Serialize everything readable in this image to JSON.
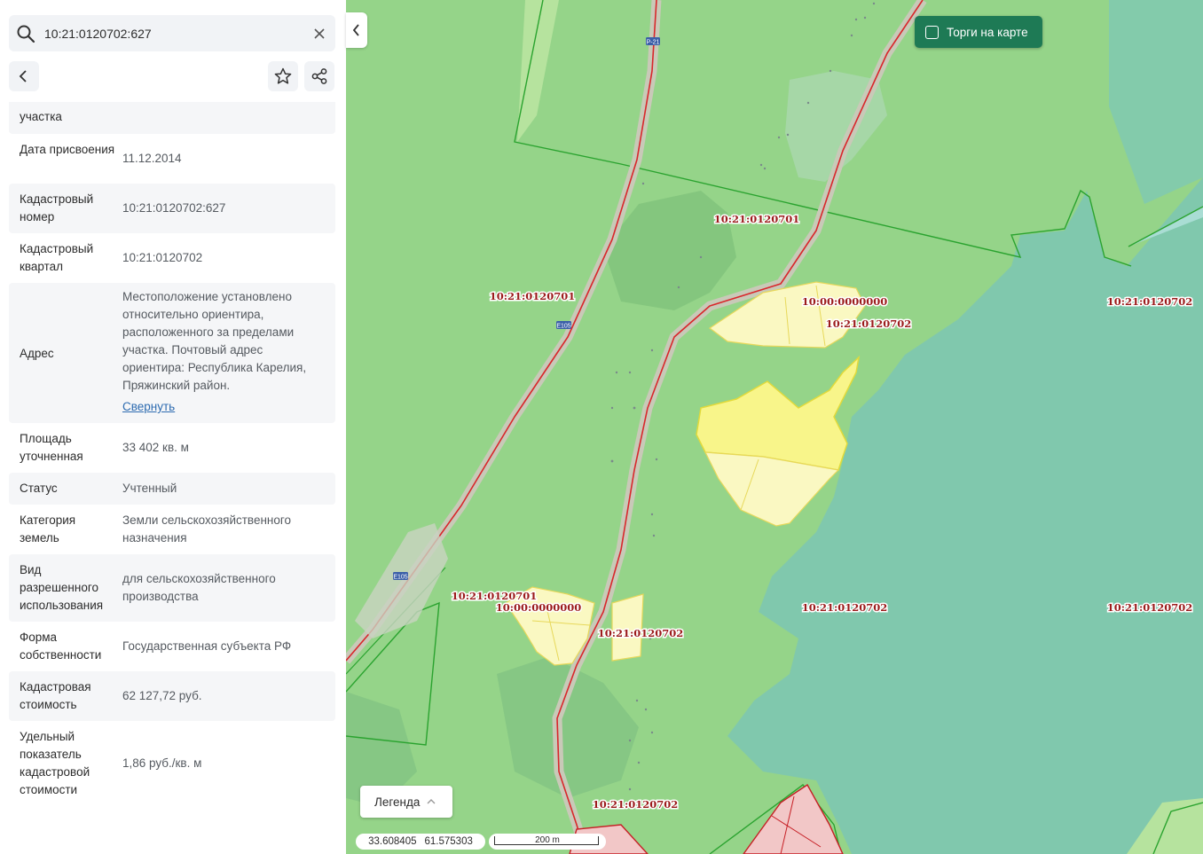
{
  "search": {
    "value": "10:21:0120702:627"
  },
  "icons": {
    "search": "search-icon",
    "clear": "close-icon",
    "back": "chevron-left-icon",
    "favorite": "star-icon",
    "share": "share-icon",
    "collapse": "chevron-left-icon",
    "legend_chevron": "chevron-up-icon"
  },
  "info": {
    "partial_label": "участка",
    "rows": [
      {
        "label": "Дата присвоения",
        "value": "11.12.2014"
      },
      {
        "label": "Кадастровый номер",
        "value": "10:21:0120702:627"
      },
      {
        "label": "Кадастровый квартал",
        "value": "10:21:0120702"
      },
      {
        "label": "Адрес",
        "value": "Местоположение установлено относительно ориентира, расположенного за пределами участка. Почтовый адрес ориентира: Республика Карелия, Пряжинский район.",
        "link": "Свернуть"
      },
      {
        "label": "Площадь уточненная",
        "value": "33 402 кв. м"
      },
      {
        "label": "Статус",
        "value": "Учтенный"
      },
      {
        "label": "Категория земель",
        "value": "Земли сельскохозяйственного назначения"
      },
      {
        "label": "Вид разрешенного использования",
        "value": "для сельскохозяйственного производства"
      },
      {
        "label": "Форма собственности",
        "value": "Государственная субъекта РФ"
      },
      {
        "label": "Кадастровая стоимость",
        "value": "62 127,72 руб."
      },
      {
        "label": "Удельный показатель кадастровой стоимости",
        "value": "1,86 руб./кв. м"
      }
    ]
  },
  "map": {
    "torgi_label": "Торги на карте",
    "legend_label": "Легенда",
    "coord_lon": "33.608405",
    "coord_lat": "61.575303",
    "scale_label": "200 m",
    "road_shield_1": "P-21",
    "road_shield_2": "E105",
    "road_shield_3": "E105",
    "labels": [
      "10:21:0120701",
      "10:21:0120701",
      "10:00:0000000",
      "10:21:0120702",
      "10:21:0120702",
      "10:21:0120701",
      "10:00:0000000",
      "10:21:0120702",
      "10:21:0120702",
      "10:21:0120702",
      "10:21:0120702"
    ]
  },
  "colors": {
    "land": "#95d489",
    "water_tint": "#80c8ad",
    "forest_dark": "#7fc37c",
    "parcel_fill": "#faf8c2",
    "parcel_selected": "#f8f58a",
    "parcel_border": "#e7d85a",
    "road_line": "#d9262b",
    "road_casing": "#c9c9b8",
    "boundary": "#2aa32f",
    "label": "#9b1b1b",
    "accent_button": "#1e7a55",
    "link": "#2d6bb0"
  }
}
